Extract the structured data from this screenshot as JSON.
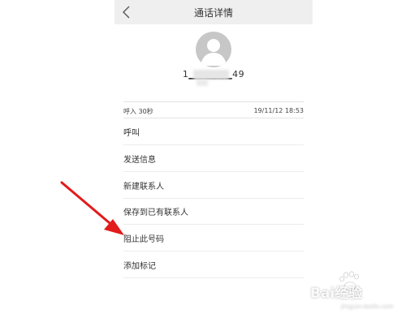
{
  "header": {
    "title": "通话详情"
  },
  "contact": {
    "number": "1▁▁▁▁▁▁49"
  },
  "call_log": {
    "type": "呼入 30秒",
    "datetime": "19/11/12 18:53"
  },
  "menu": [
    {
      "label": "呼叫"
    },
    {
      "label": "发送信息"
    },
    {
      "label": "新建联系人"
    },
    {
      "label": "保存到已有联系人"
    },
    {
      "label": "阻止此号码"
    },
    {
      "label": "添加标记"
    }
  ],
  "watermark": {
    "text": "Bai经验",
    "sub": "jingyan.baidu.com"
  },
  "colors": {
    "arrow": "#e21b1b",
    "titlebar": "#efefef",
    "avatar": "#c7c7c7"
  }
}
